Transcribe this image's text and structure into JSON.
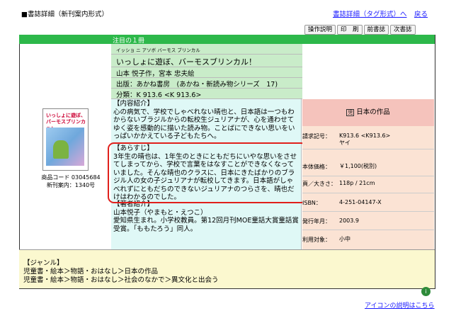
{
  "header": {
    "title": "■書誌詳細（新刊案内形式）",
    "link_tag": "書誌詳細（タグ形式）へ",
    "link_back": "戻る"
  },
  "toolbar": {
    "help": "操作説明",
    "print": "印　刷",
    "prev": "前書誌",
    "next": "次書誌"
  },
  "section_header": "注目の１冊",
  "book": {
    "kana": "イッショ ニ アソボ バーモス ブリンカル",
    "title": "いっしょに遊ぼ、バーモスブリンカル！",
    "author": "山本 悦子作，宮本 忠夫絵",
    "publisher": "出版：あかね書房　(あかね・新読み物シリーズ　17)",
    "classification": "分類：K 913.6 <K 913.6>",
    "cover_line1": "いっしょに遊ぼ、",
    "cover_line2": "バーモスブリンカル！",
    "product_code": "商品コード 03045684",
    "shinkan_no": "新刊案内：1340号"
  },
  "description": {
    "content_head": "【内容紹介】",
    "content_body": "心の病気で、学校でしゃべれない晴也と、日本語は一つもわからないブラジルからの転校生ジュリアナが、心を通わせてゆく姿を感動的に描いた読み物。ことばにできない思いをいっぱいかかえている子どもたちへ。",
    "synopsis_head": "【あらすじ】",
    "synopsis_body": "3年生の晴也は、1年生のときにともだちにいやな思いをさせてしまってから、学校で言葉をはなすことができなくなっていました。そんな晴也のクラスに、日本にきたばかりのブラジル人の女の子ジュリアナが転校してきます。日本語がしゃべれずにともだちのできないジュリアナのつらさを、晴也だけはわかるのでした。",
    "author_head": "【著者紹介】",
    "author_name": "山本悦子（やまもと・えつこ）",
    "author_body": "愛知県生まれ。小学校教員。第12回月刊MOE童話大賞童話賞受賞。「ももたろう」同人。"
  },
  "details": {
    "category_mark": "児",
    "category": "日本の作品",
    "rows": [
      {
        "label": "請求記号：",
        "value": "K913.6 <K913.6>",
        "value2": "ヤイ"
      },
      {
        "label": "本体価格：",
        "value": "￥1,100(税別)"
      },
      {
        "label": "頁／大きさ：",
        "value": "118p / 21cm"
      },
      {
        "label": "ISBN：",
        "value": "4-251-04147-X"
      },
      {
        "label": "発行年月：",
        "value": "2003.9"
      },
      {
        "label": "利用対象：",
        "value": "小中"
      }
    ]
  },
  "genre": {
    "head": "【ジャンル】",
    "line1": "児童書・絵本＞物語・おはなし＞日本の作品",
    "line2": "児童書・絵本＞物語・おはなし＞社会のなかで＞異文化と出会う"
  },
  "footer": {
    "icon_link": "アイコンの説明はこちら"
  }
}
